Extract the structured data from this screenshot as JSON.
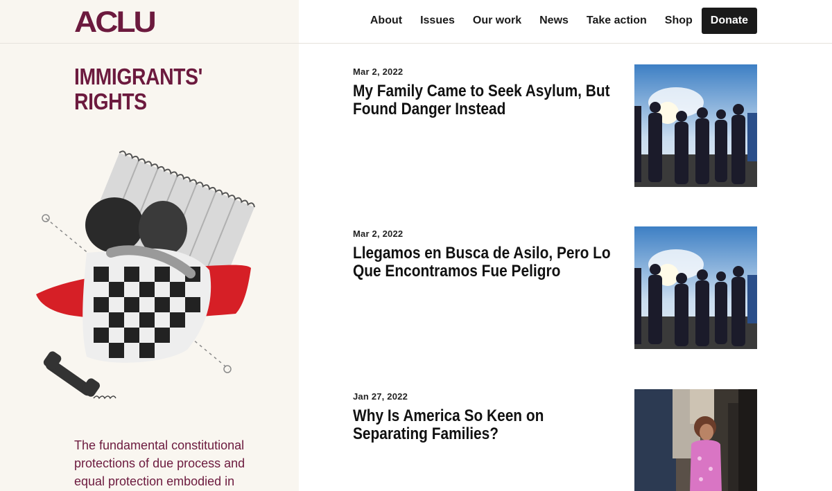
{
  "header": {
    "logo": "ACLU",
    "nav": [
      "About",
      "Issues",
      "Our work",
      "News",
      "Take action",
      "Shop"
    ],
    "donate_label": "Donate"
  },
  "section": {
    "title": "IMMIGRANTS' RIGHTS",
    "intro": "The fundamental constitutional protections of due process and equal protection embodied in"
  },
  "articles": [
    {
      "date": "Mar 2, 2022",
      "title": "My Family Came to Seek Asylum, But Found Danger Instead"
    },
    {
      "date": "Mar 2, 2022",
      "title": "Llegamos en Busca de Asilo, Pero Lo Que Encontramos Fue Peligro"
    },
    {
      "date": "Jan 27, 2022",
      "title": "Why Is America So Keen on Separating Families?"
    }
  ],
  "colors": {
    "brand": "#6c1a3e",
    "panel": "#f9f6f0",
    "accent_red": "#d61f26"
  }
}
